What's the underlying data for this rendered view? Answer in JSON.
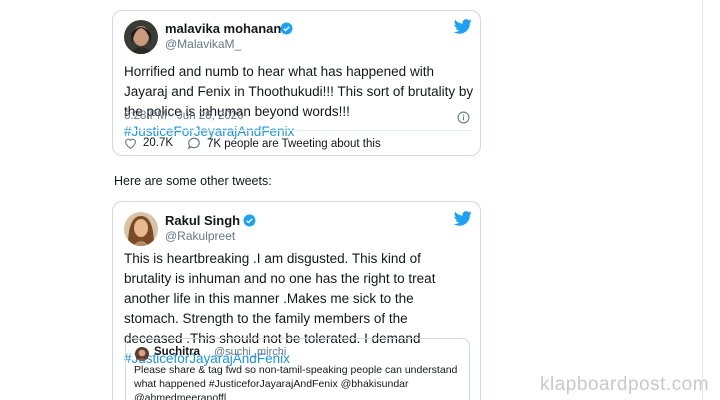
{
  "tweet1": {
    "display_name": "malavika mohanan",
    "handle": "@MalavikaM_",
    "text_pre": "Horrified and numb to hear what has happened with Jayaraj and Fenix in Thoothukudi!!! This sort of brutality by the police is inhuman beyond words!!! ",
    "hashtag": "#JusticeForJeyarajAndFenix",
    "timestamp": "6:28 PM · Jun 26, 2020",
    "likes": "20.7K",
    "people_tweeting": "7K people are Tweeting about this"
  },
  "between_text": "Here are some other tweets:",
  "tweet2": {
    "display_name": "Rakul Singh",
    "handle": "@Rakulpreet",
    "text_pre": "This is heartbreaking .I am disgusted. This kind of brutality is inhuman and no one has the right to treat another life in this manner .Makes me sick to the stomach. Strength to the family members of the deceased .This should not be tolerated. I demand ",
    "hashtag": "#JusticeforJayarajAndFenix",
    "quote": {
      "display_name": "Suchitra",
      "handle": "@suchi_mirchi",
      "text": "Please share & tag fwd so non-tamil-speaking people can understand what happened #JusticeforJayarajAndFenix @bhakisundar @ahmedmeeranoffl"
    }
  },
  "watermark": "klapboardpost.com",
  "colors": {
    "link": "#1b95e0",
    "twitter_blue": "#1da1f2",
    "muted": "#657786"
  }
}
